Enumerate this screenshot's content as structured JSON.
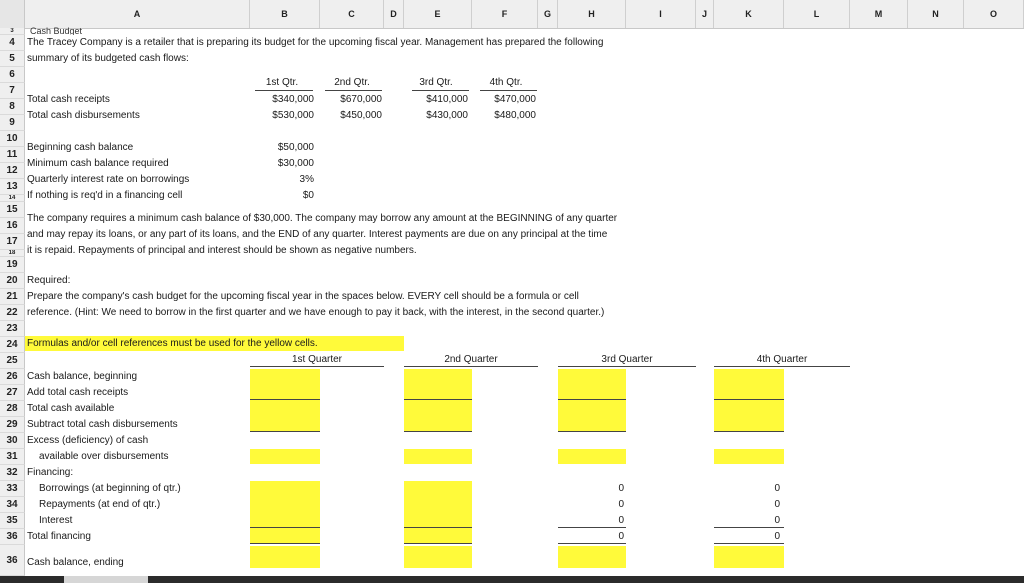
{
  "columns": [
    "A",
    "B",
    "C",
    "D",
    "E",
    "F",
    "G",
    "H",
    "I",
    "J",
    "K",
    "L",
    "M",
    "N",
    "O"
  ],
  "rows": {
    "r3": "Cash Budget",
    "r4": "The Tracey Company is a retailer that is preparing its budget for the upcoming fiscal year. Management has prepared the following",
    "r5": "summary of its budgeted cash flows:",
    "quarters": [
      "1st Qtr.",
      "2nd Qtr.",
      "3rd Qtr.",
      "4th Qtr."
    ],
    "r7_label": "Total cash receipts",
    "r7_values": [
      "$340,000",
      "$670,000",
      "$410,000",
      "$470,000"
    ],
    "r8_label": "Total cash disbursements",
    "r8_values": [
      "$530,000",
      "$450,000",
      "$430,000",
      "$480,000"
    ],
    "r10_label": "Beginning cash balance",
    "r10_value": "$50,000",
    "r11_label": "Minimum cash balance required",
    "r11_value": "$30,000",
    "r12_label": "Quarterly interest rate on borrowings",
    "r12_value": "3%",
    "r13_label": "If nothing is req'd in a financing cell",
    "r13_value": "$0",
    "r15": "The company requires a minimum cash balance of $30,000. The company may borrow any amount at the BEGINNING of any quarter",
    "r16": "and may repay its loans, or any part of its loans, and the END of any quarter. Interest payments are due on any principal at the time",
    "r17": "it is repaid. Repayments of principal and interest should be shown as negative numbers.",
    "r19": "Required:",
    "r20": "Prepare the company's cash budget for the upcoming fiscal year in the spaces below. EVERY cell should be a formula or cell",
    "r21": "reference. (Hint: We need to borrow in the first quarter and we have enough to pay it back, with the interest, in the second quarter.)",
    "r23": "Formulas and/or cell references must be used for the yellow cells.",
    "r24_quarters": [
      "1st Quarter",
      "2nd Quarter",
      "3rd Quarter",
      "4th Quarter"
    ],
    "r25": "Cash balance, beginning",
    "r26": "Add total cash receipts",
    "r27": "Total cash available",
    "r28": "Subtract total cash disbursements",
    "r29": "Excess (deficiency) of cash",
    "r30": "available over disbursements",
    "r31": "Financing:",
    "r32": "Borrowings (at beginning of qtr.)",
    "r33": "Repayments (at end of qtr.)",
    "r34": "Interest",
    "r35": "Total financing",
    "r36": "Cash balance, ending",
    "zero": "0"
  },
  "row_numbers": [
    "3",
    "4",
    "5",
    "6",
    "7",
    "8",
    "9",
    "10",
    "11",
    "12",
    "13",
    "14",
    "15",
    "16",
    "17",
    "18",
    "19",
    "20",
    "21",
    "22",
    "23",
    "24",
    "25",
    "26",
    "27",
    "28",
    "29",
    "30",
    "31",
    "32",
    "33",
    "34",
    "35",
    "36"
  ],
  "colors": {
    "highlight": "#fffa3a",
    "header_bg": "#efefef"
  }
}
